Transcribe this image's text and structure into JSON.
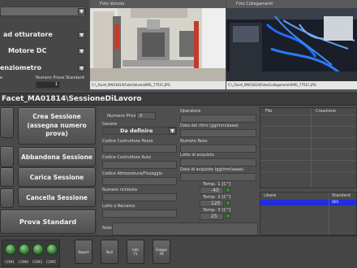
{
  "top_left": {
    "rows": [
      "ad otturatore",
      "Motore DC",
      "enziometro"
    ],
    "footer_left": "e",
    "footer_right": "Numero Prove Standard",
    "num_prove_value": "1"
  },
  "image_left": {
    "caption": "Foto Valvola",
    "path": "C:\\_Facet_MA01814\\Foto\\Valvola\\IMG_7751C.JPG"
  },
  "image_right": {
    "caption": "Foto Collegamenti",
    "path": "C:\\_Facet_MA01814\\Foto\\Collegamenti\\IMG_7751C.JPG"
  },
  "path_bar": "Facet_MA01814\\SessioneDiLavoro",
  "buttons": {
    "crea": "Crea Sessione\n(assegna numero prova)",
    "abbandona": "Abbandona Sessione",
    "carica": "Carica Sessione",
    "cancella": "Cancella Sessione",
    "prova": "Prova Standard"
  },
  "form": {
    "numero_prova_label": "Numero Prova",
    "numero_prova_value": "0",
    "genere_label": "Genere",
    "genere_value": "Da definire",
    "codice_pezzo": "Codice Costruttore Pezzo",
    "codice_auto": "Codice Costruttore Auto",
    "codice_attrezzatura": "Codice Attrezzatura/Fissaggio",
    "numero_richiesta": "Numero richiesta",
    "lotto_reclamo": "Lotto o Reclamo",
    "note": "Note"
  },
  "right_form": {
    "operatore": "Operatore",
    "data_ritiro": "Data del ritiro (gg/mm/aaaa)",
    "numero_reso": "Numero Reso",
    "lotto_acquisto": "Lotto di acquisto",
    "data_acquisto": "Data di acquisto (gg/mm/aaaa)",
    "temp1_label": "Temp. 1 [C°]",
    "temp1_value": "-40",
    "temp2_label": "Temp. 2 [C°]",
    "temp2_value": "120",
    "temp3_label": "Temp. 3 [C°]",
    "temp3_value": "25"
  },
  "file_table": {
    "col1": "File",
    "col2": "Creazione"
  },
  "libere_table": {
    "col1": "Libere",
    "col2": "Standard",
    "row1_col2": "001"
  },
  "bottom_buttons": [
    {
      "l1": "Report",
      "l2": ""
    },
    {
      "l1": "Null",
      "l2": ""
    },
    {
      "l1": "Info",
      "l2": "F1"
    },
    {
      "l1": "Esegui",
      "l2": "F6"
    }
  ],
  "com_labels": [
    "COM1",
    "COM4",
    "COM3",
    "COM5"
  ]
}
